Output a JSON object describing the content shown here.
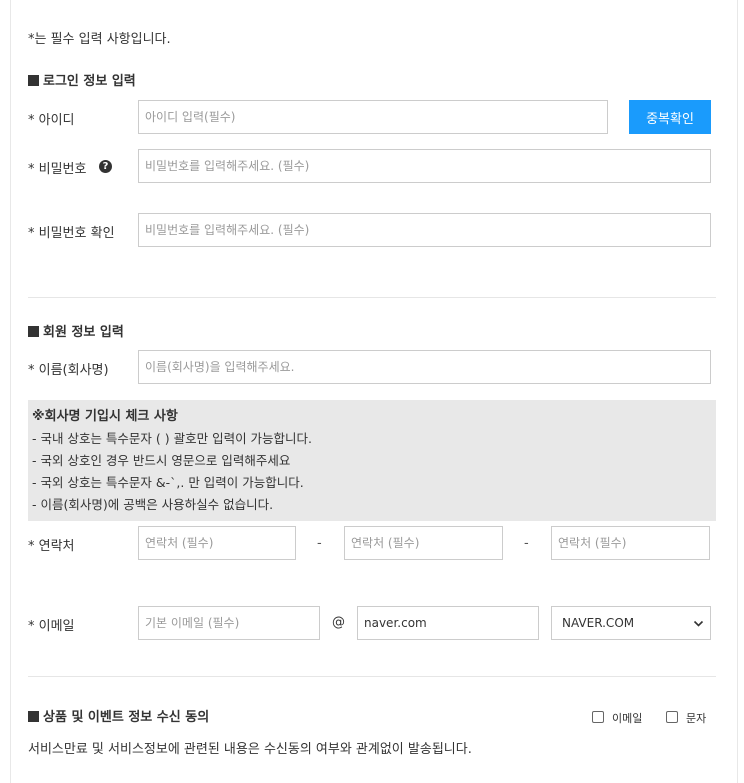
{
  "note": "*는 필수 입력 사항입니다.",
  "login_section": {
    "title": "로그인 정보 입력",
    "id_label": "* 아이디",
    "id_placeholder": "아이디 입력(필수)",
    "dup_check_button": "중복확인",
    "password_label": "* 비밀번호",
    "help_icon_glyph": "?",
    "password_placeholder": "비밀번호를 입력해주세요. (필수)",
    "password_confirm_label": "* 비밀번호 확인",
    "password_confirm_placeholder": "비밀번호를 입력해주세요. (필수)"
  },
  "member_section": {
    "title": "회원 정보 입력",
    "name_label": "* 이름(회사명)",
    "name_placeholder": "이름(회사명)을 입력해주세요.",
    "notice": {
      "title": "※회사명 기입시 체크 사항",
      "lines": [
        "- 국내 상호는 특수문자 ( ) 괄호만 입력이 가능합니다.",
        "- 국외 상호인 경우 반드시 영문으로 입력해주세요",
        "- 국외 상호는 특수문자 &-`,. 만 입력이 가능합니다.",
        "- 이름(회사명)에 공백은 사용하실수 없습니다."
      ]
    },
    "phone_label": "* 연락처",
    "phone_placeholders": [
      "연락처 (필수)",
      "연락처 (필수)",
      "연락처 (필수)"
    ],
    "phone_separator": "-",
    "email_label": "* 이메일",
    "email_id_placeholder": "기본 이메일 (필수)",
    "email_at": "@",
    "email_domain_value": "naver.com",
    "email_domain_select": "NAVER.COM"
  },
  "consent_section": {
    "title": "상품 및 이벤트 정보 수신 동의",
    "checkbox_email": "이메일",
    "checkbox_sms": "문자",
    "description": "서비스만료 및 서비스정보에 관련된 내용은 수신동의 여부와 관계없이 발송됩니다."
  },
  "colors": {
    "accent": "#1a9bfc",
    "notice_bg": "#e8e8e8",
    "border": "#cccccc",
    "text": "#333333"
  },
  "icons": {
    "help": "question-circle-icon",
    "select": "chevron-down-icon"
  }
}
